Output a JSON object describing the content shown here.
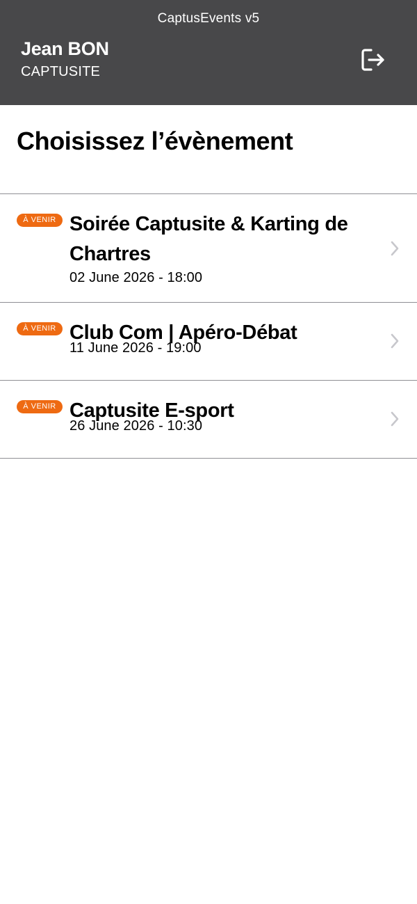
{
  "header": {
    "app_title": "CaptusEvents v5",
    "user_name": "Jean BON",
    "company": "CAPTUSITE",
    "logout_icon": "logout-icon"
  },
  "page": {
    "title": "Choisissez l’évènement"
  },
  "events": [
    {
      "badge": "À VENIR",
      "title": "Soirée Captusite & Karting de Chartres",
      "date": "02 June 2026 - 18:00"
    },
    {
      "badge": "À VENIR",
      "title": "Club Com | Apéro-Débat",
      "date": "11 June 2026 - 19:00"
    },
    {
      "badge": "À VENIR",
      "title": "Captusite E-sport",
      "date": "26 June 2026 - 10:30"
    }
  ],
  "colors": {
    "header_bg": "#48484a",
    "badge_bg": "#ee6a12",
    "divider": "#8e8e93",
    "chevron": "#c7c7cc"
  }
}
